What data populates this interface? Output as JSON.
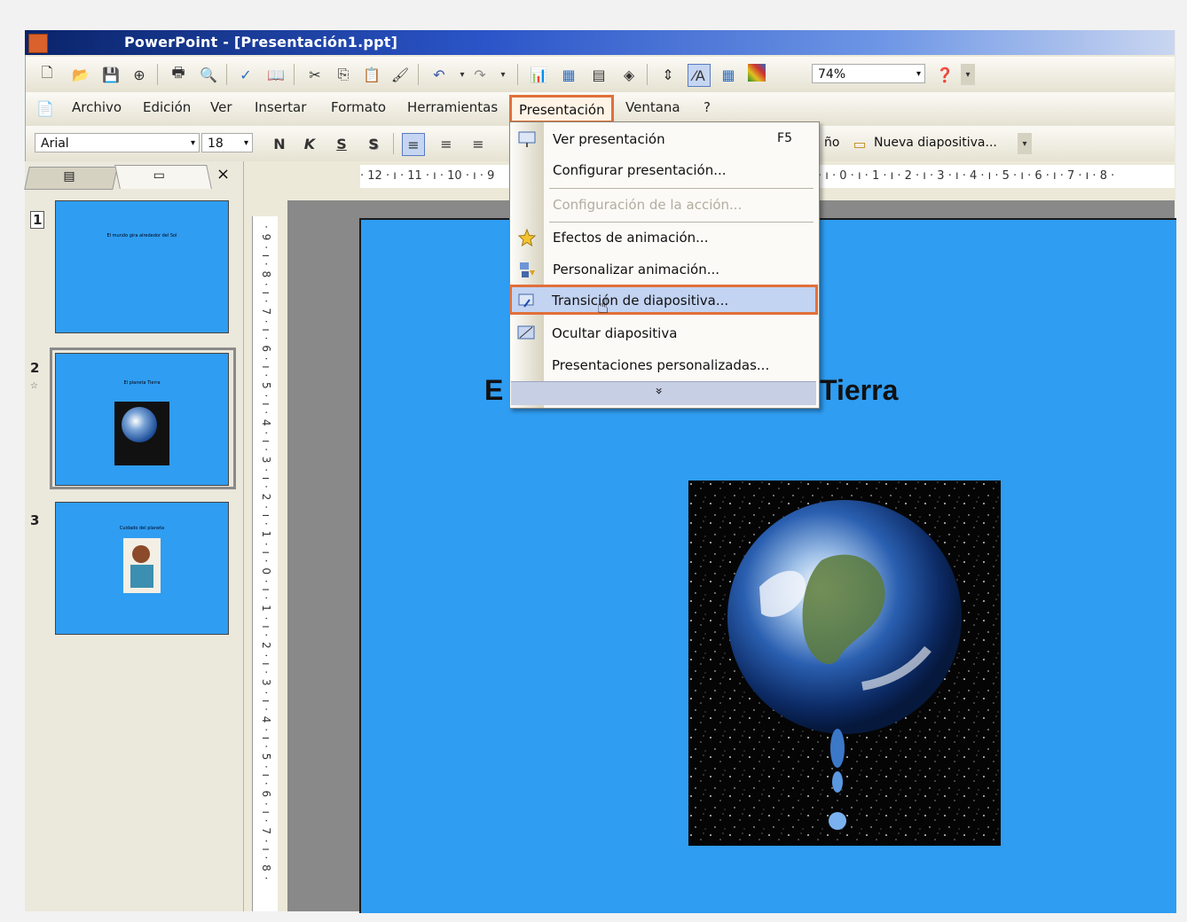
{
  "window": {
    "title": "PowerPoint - [Presentación1.ppt]"
  },
  "toolbar": {
    "zoom": "74%"
  },
  "menubar": {
    "items": [
      {
        "label": "Archivo"
      },
      {
        "label": "Edición"
      },
      {
        "label": "Ver"
      },
      {
        "label": "Insertar"
      },
      {
        "label": "Formato"
      },
      {
        "label": "Herramientas"
      },
      {
        "label": "Presentación"
      },
      {
        "label": "Ventana"
      },
      {
        "label": "?"
      }
    ]
  },
  "formatbar": {
    "font": "Arial",
    "size": "18",
    "bold": "N",
    "italic": "K",
    "underline": "S",
    "shadow": "S",
    "design_label": "ño",
    "new_slide_label": "Nueva diapositiva..."
  },
  "panes": {
    "close": "×"
  },
  "ruler": {
    "left": "· 12 · ı · 11 · ı · 10 · ı · 9",
    "right": "· ı · 0 · ı · 1 · ı · 2 · ı · 3 · ı · 4 · ı · 5 · ı · 6 · ı · 7 · ı · 8 ·",
    "vertical": "· 9 · ı · 8 · ı · 7 · ı · 6 · ı · 5 · ı · 4 · ı · 3 · ı · 2 · ı · 1 · ı · 0 · ı · 1 · ı · 2 · ı · 3 · ı · 4 · ı · 5 · ı · 6 · ı · 7 · ı · 8 ·"
  },
  "slides": [
    {
      "num": "1",
      "title": "El mundo gira alrededor del Sol"
    },
    {
      "num": "2",
      "title": "El planeta Tierra"
    },
    {
      "num": "3",
      "title": "Cuidado del planeta"
    }
  ],
  "main_slide": {
    "title_left": "E",
    "title_right": "Tierra"
  },
  "dropdown": {
    "items": [
      {
        "label": "Ver presentación",
        "shortcut": "F5",
        "icon": "projector-icon"
      },
      {
        "label": "Configurar presentación...",
        "icon": ""
      },
      {
        "label": "Configuración de la acción...",
        "disabled": true
      },
      {
        "label": "Efectos de animación...",
        "icon": "star-effects-icon"
      },
      {
        "label": "Personalizar animación...",
        "icon": "custom-animation-icon"
      },
      {
        "label": "Transición de diapositiva...",
        "icon": "transition-icon",
        "highlighted": true
      },
      {
        "label": "Ocultar diapositiva",
        "icon": "hide-slide-icon"
      },
      {
        "label": "Presentaciones personalizadas..."
      }
    ],
    "expand": "»"
  },
  "colors": {
    "slide_bg": "#2f9df2",
    "highlight_border": "#e0703a",
    "title_bar_start": "#0a246a"
  }
}
